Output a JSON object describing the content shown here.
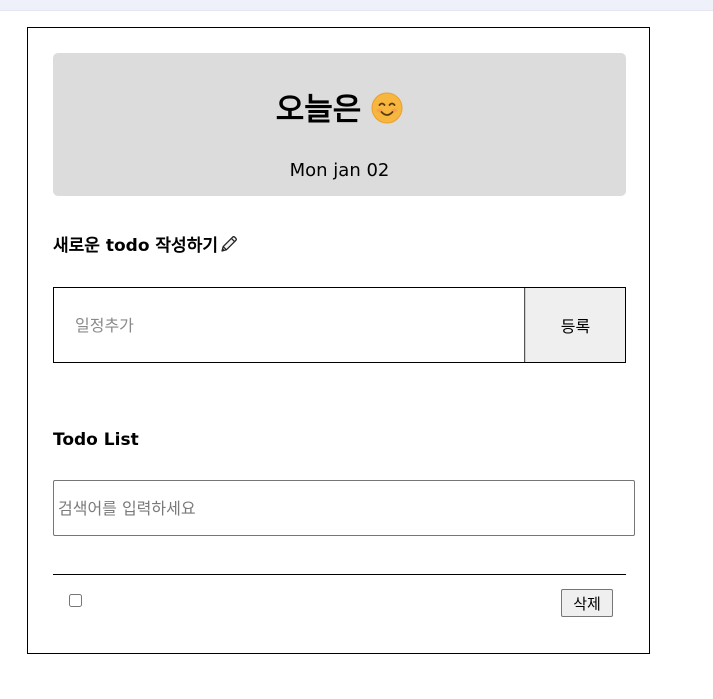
{
  "header": {
    "title": "오늘은",
    "emoji_icon": "smiling-face-icon",
    "date": "Mon jan 02"
  },
  "new_todo": {
    "title": "새로운 todo 작성하기",
    "title_icon": "pencil-icon",
    "input_placeholder": "일정추가",
    "input_value": "",
    "add_label": "등록"
  },
  "todo_list": {
    "title": "Todo List",
    "search_placeholder": "검색어를 입력하세요",
    "search_value": "",
    "items": [
      {
        "checked": false,
        "delete_label": "삭제"
      }
    ]
  },
  "colors": {
    "header_bg": "#dcdcdc",
    "button_bg": "#efefef",
    "topbar_bg": "#eef1fa"
  }
}
